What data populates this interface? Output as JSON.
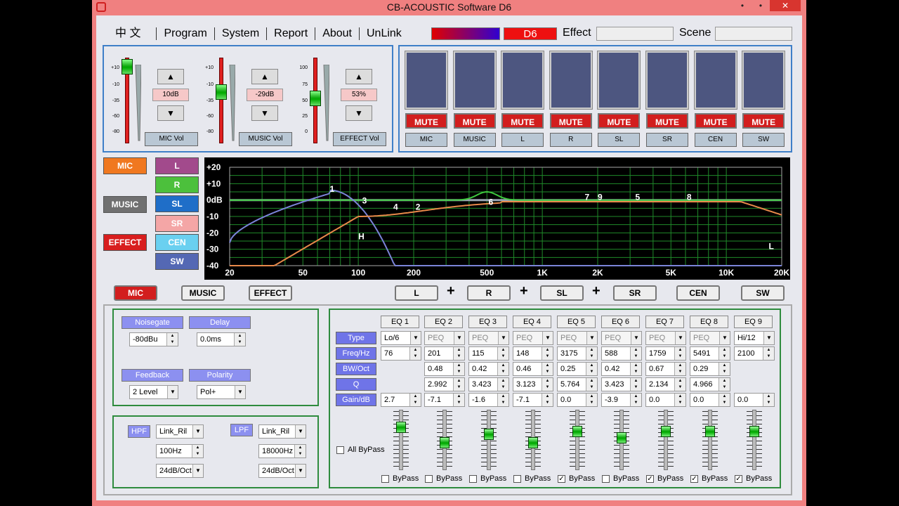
{
  "window": {
    "title": "CB-ACOUSTIC Software D6",
    "min": "•",
    "restore": "•",
    "close": "✕"
  },
  "menu": [
    "中 文",
    "Program",
    "System",
    "Report",
    "About",
    "UnLink"
  ],
  "device": "D6",
  "effect_label": "Effect",
  "scene_label": "Scene",
  "volumes": [
    {
      "name": "MIC Vol",
      "value": "10dB",
      "level": 0.98,
      "scale": [
        "+10",
        "-10",
        "-35",
        "-60",
        "-80"
      ]
    },
    {
      "name": "MUSIC Vol",
      "value": "-29dB",
      "level": 0.62,
      "scale": [
        "+10",
        "-10",
        "-35",
        "-60",
        "-80"
      ]
    },
    {
      "name": "EFFECT Vol",
      "value": "53%",
      "level": 0.53,
      "scale": [
        "100",
        "75",
        "50",
        "25",
        "0"
      ]
    }
  ],
  "mute_label": "MUTE",
  "outputs": [
    "MIC",
    "MUSIC",
    "L",
    "R",
    "SL",
    "SR",
    "CEN",
    "SW"
  ],
  "sources": [
    "MIC",
    "MUSIC",
    "EFFECT"
  ],
  "out_channels": [
    "L",
    "R",
    "SL",
    "SR",
    "CEN",
    "SW"
  ],
  "colors": {
    "mic": "#f07820",
    "music": "#707070",
    "effect": "#d81e1e",
    "L": "#a24a8c",
    "R": "#4cc03c",
    "SL": "#1f6ec8",
    "SR": "#f4a6a6",
    "CEN": "#6ad0f0",
    "SW": "#5468b4"
  },
  "graph": {
    "y_ticks": [
      "+20",
      "+10",
      "0dB",
      "-10",
      "-20",
      "-30",
      "-40"
    ],
    "x_ticks": [
      "20",
      "50",
      "100",
      "200",
      "500",
      "1K",
      "2K",
      "5K",
      "10K",
      "20K"
    ],
    "markers": [
      "1",
      "3",
      "4",
      "2",
      "6",
      "7",
      "9",
      "5",
      "8",
      "H",
      "L"
    ]
  },
  "sel_sources": [
    "MIC",
    "MUSIC",
    "EFFECT"
  ],
  "sel_outputs": [
    "L",
    "R",
    "SL",
    "SR",
    "CEN",
    "SW"
  ],
  "plus": "+",
  "dyn": {
    "noisegate": "Noisegate",
    "noisegate_val": "-80dBu",
    "delay": "Delay",
    "delay_val": "0.0ms",
    "feedback": "Feedback",
    "feedback_val": "2 Level",
    "polarity": "Polarity",
    "polarity_val": "Pol+"
  },
  "filters": {
    "hpf": "HPF",
    "hpf_type": "Link_Ril",
    "hpf_freq": "100Hz",
    "hpf_slope": "24dB/Oct",
    "lpf": "LPF",
    "lpf_type": "Link_Ril",
    "lpf_freq": "18000Hz",
    "lpf_slope": "24dB/Oct"
  },
  "eq": {
    "headers": [
      "EQ 1",
      "EQ 2",
      "EQ 3",
      "EQ 4",
      "EQ 5",
      "EQ 6",
      "EQ 7",
      "EQ 8",
      "EQ 9"
    ],
    "row_labels": [
      "Type",
      "Freq/Hz",
      "BW/Oct",
      "Q",
      "Gain/dB"
    ],
    "type": [
      "Lo/6",
      "PEQ",
      "PEQ",
      "PEQ",
      "PEQ",
      "PEQ",
      "PEQ",
      "PEQ",
      "Hi/12"
    ],
    "freq": [
      "76",
      "201",
      "115",
      "148",
      "3175",
      "588",
      "1759",
      "5491",
      "2100"
    ],
    "bw": [
      "",
      "0.48",
      "0.42",
      "0.46",
      "0.25",
      "0.42",
      "0.67",
      "0.29",
      ""
    ],
    "q": [
      "",
      "2.992",
      "3.423",
      "3.123",
      "5.764",
      "3.423",
      "2.134",
      "4.966",
      ""
    ],
    "gain": [
      "2.7",
      "-7.1",
      "-1.6",
      "-7.1",
      "0.0",
      "-3.9",
      "0.0",
      "0.0",
      "0.0"
    ],
    "bypass_checked": [
      false,
      false,
      false,
      false,
      true,
      false,
      true,
      true,
      true
    ],
    "bypass_label": "ByPass",
    "all_bypass": "All ByPass"
  }
}
